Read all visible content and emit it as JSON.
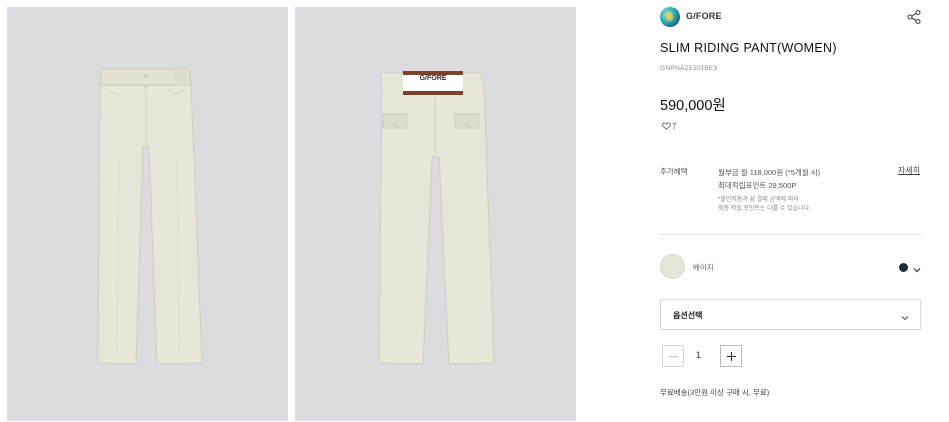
{
  "product": {
    "brand": "G/FORE",
    "title": "SLIM RIDING PANT(WOMEN)",
    "code": "GNPNA25302BEX",
    "price": "590,000원",
    "likes": "7",
    "waistband_text": "G/FORE"
  },
  "benefits": {
    "label": "추가혜택",
    "line1": "월부금 월 118,000원 (*5개월 시)",
    "line2": "최대적립포인트 29,500P",
    "note1": "*할인적용과 쉼 결제 금액에 따라",
    "note2": "최종 적립 포인트는 다를 수 있습니다.",
    "detail_link": "자세히"
  },
  "color": {
    "name": "베이지",
    "swatch_hex": "#e6e5d8",
    "alt_dot_hex": "#1e2a3a"
  },
  "option_select": {
    "label": "옵션선택"
  },
  "quantity": {
    "value": "1"
  },
  "shipping": {
    "text": "무료배송(3만원 이상 구매 시, 무료)"
  },
  "icons": {
    "share": "share-icon",
    "heart": "heart-icon",
    "chevron": "chevron-down-icon"
  }
}
